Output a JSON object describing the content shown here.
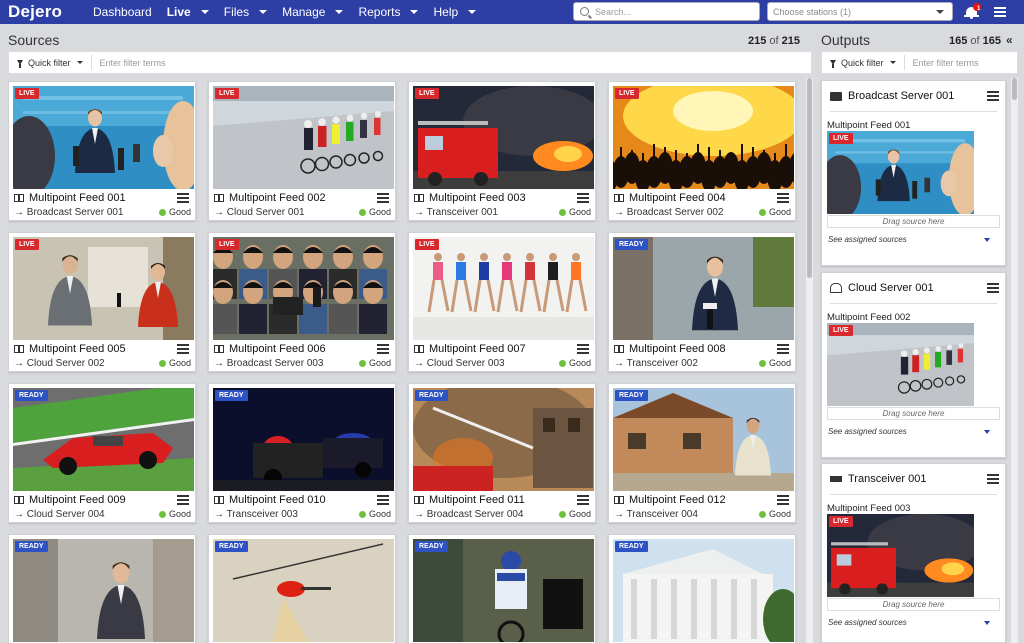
{
  "nav": {
    "logo": "Dejero",
    "items": [
      {
        "label": "Dashboard",
        "caret": false,
        "active": false
      },
      {
        "label": "Live",
        "caret": true,
        "active": true
      },
      {
        "label": "Files",
        "caret": true,
        "active": false
      },
      {
        "label": "Manage",
        "caret": true,
        "active": false
      },
      {
        "label": "Reports",
        "caret": true,
        "active": false
      },
      {
        "label": "Help",
        "caret": true,
        "active": false
      }
    ],
    "search_placeholder": "Search...",
    "stations_placeholder": "Choose stations (1)",
    "notification_count": "1"
  },
  "sources": {
    "title": "Sources",
    "count_shown": "215",
    "count_sep": " of ",
    "count_total": "215",
    "filter": {
      "quick_filter_label": "Quick filter",
      "placeholder": "Enter filter terms"
    },
    "feeds": [
      {
        "name": "Multipoint Feed 001",
        "dest": "→ Broadcast Server 001",
        "status": "Good",
        "badge": "LIVE",
        "kind": "live",
        "scene": "press"
      },
      {
        "name": "Multipoint Feed 002",
        "dest": "→ Cloud Server 001",
        "status": "Good",
        "badge": "LIVE",
        "kind": "live",
        "scene": "cycling"
      },
      {
        "name": "Multipoint Feed 003",
        "dest": "→ Transceiver 001",
        "status": "Good",
        "badge": "LIVE",
        "kind": "live",
        "scene": "firetruck"
      },
      {
        "name": "Multipoint Feed 004",
        "dest": "→ Broadcast Server 002",
        "status": "Good",
        "badge": "LIVE",
        "kind": "live",
        "scene": "concert"
      },
      {
        "name": "Multipoint Feed 005",
        "dest": "→ Cloud Server 002",
        "status": "Good",
        "badge": "LIVE",
        "kind": "live",
        "scene": "interview"
      },
      {
        "name": "Multipoint Feed 006",
        "dest": "→ Broadcast Server 003",
        "status": "Good",
        "badge": "LIVE",
        "kind": "live",
        "scene": "crowd"
      },
      {
        "name": "Multipoint Feed 007",
        "dest": "→ Cloud Server 003",
        "status": "Good",
        "badge": "LIVE",
        "kind": "live",
        "scene": "runners"
      },
      {
        "name": "Multipoint Feed 008",
        "dest": "→ Transceiver 002",
        "status": "Good",
        "badge": "READY",
        "kind": "ready",
        "scene": "reporter"
      },
      {
        "name": "Multipoint Feed 009",
        "dest": "→ Cloud Server 004",
        "status": "Good",
        "badge": "READY",
        "kind": "ready",
        "scene": "racecar"
      },
      {
        "name": "Multipoint Feed 010",
        "dest": "→ Transceiver 003",
        "status": "Good",
        "badge": "READY",
        "kind": "ready",
        "scene": "police"
      },
      {
        "name": "Multipoint Feed 011",
        "dest": "→ Broadcast Server 004",
        "status": "Good",
        "badge": "READY",
        "kind": "ready",
        "scene": "fire"
      },
      {
        "name": "Multipoint Feed 012",
        "dest": "→ Transceiver 004",
        "status": "Good",
        "badge": "READY",
        "kind": "ready",
        "scene": "house"
      },
      {
        "name": "",
        "dest": "",
        "status": "",
        "badge": "READY",
        "kind": "ready",
        "scene": "anchor"
      },
      {
        "name": "",
        "dest": "",
        "status": "",
        "badge": "READY",
        "kind": "ready",
        "scene": "helicopter"
      },
      {
        "name": "",
        "dest": "",
        "status": "",
        "badge": "READY",
        "kind": "ready",
        "scene": "moto"
      },
      {
        "name": "",
        "dest": "",
        "status": "",
        "badge": "READY",
        "kind": "ready",
        "scene": "building"
      }
    ]
  },
  "outputs": {
    "title": "Outputs",
    "count_shown": "165",
    "count_sep": " of ",
    "count_total": "165",
    "filter": {
      "quick_filter_label": "Quick filter",
      "placeholder": "Enter filter terms"
    },
    "items": [
      {
        "name": "Broadcast Server 001",
        "icon": "server",
        "feed": "Multipoint Feed 001",
        "badge": "LIVE",
        "scene": "press",
        "drag": "Drag source here",
        "see": "See assigned sources"
      },
      {
        "name": "Cloud Server 001",
        "icon": "cloud",
        "feed": "Multipoint Feed 002",
        "badge": "LIVE",
        "scene": "cycling",
        "drag": "Drag source here",
        "see": "See assigned sources"
      },
      {
        "name": "Transceiver 001",
        "icon": "transceiver",
        "feed": "Multipoint Feed 003",
        "badge": "LIVE",
        "scene": "firetruck",
        "drag": "Drag source here",
        "see": "See assigned sources"
      }
    ]
  },
  "colors": {
    "nav": "#2d3ea5",
    "live": "#d9272e",
    "ready": "#2d52c4",
    "good": "#6cc13c"
  }
}
